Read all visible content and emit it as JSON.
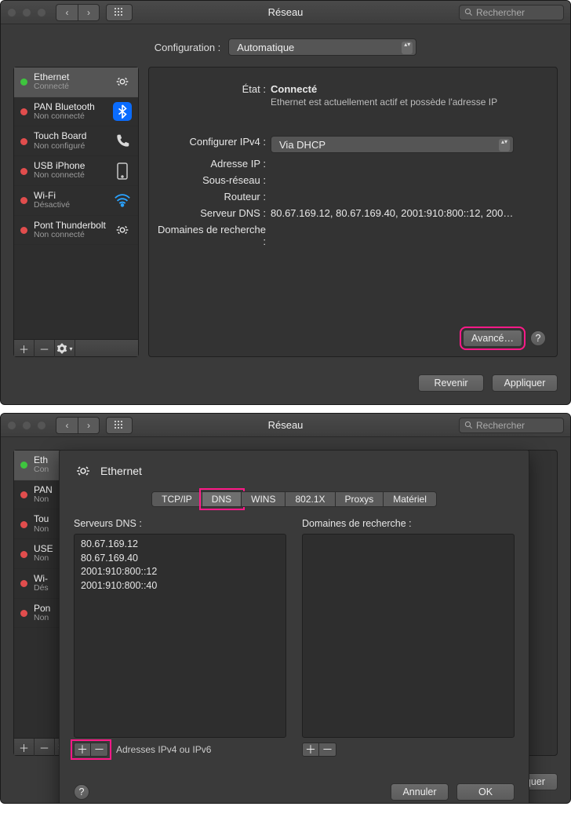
{
  "window1": {
    "title": "Réseau",
    "search_placeholder": "Rechercher",
    "config_label": "Configuration :",
    "config_value": "Automatique",
    "sidebar": {
      "items": [
        {
          "name": "Ethernet",
          "sub": "Connecté",
          "status": "green",
          "icon": "ethernet"
        },
        {
          "name": "PAN Bluetooth",
          "sub": "Non connecté",
          "status": "red",
          "icon": "bluetooth"
        },
        {
          "name": "Touch Board",
          "sub": "Non configuré",
          "status": "red",
          "icon": "phone"
        },
        {
          "name": "USB iPhone",
          "sub": "Non connecté",
          "status": "red",
          "icon": "iphone"
        },
        {
          "name": "Wi-Fi",
          "sub": "Désactivé",
          "status": "red",
          "icon": "wifi"
        },
        {
          "name": "Pont Thunderbolt",
          "sub": "Non connecté",
          "status": "red",
          "icon": "ethernet"
        }
      ]
    },
    "detail": {
      "state_label": "État :",
      "state_value": "Connecté",
      "state_desc": "Ethernet est actuellement actif et possède l'adresse IP",
      "ipv4_label": "Configurer IPv4 :",
      "ipv4_value": "Via DHCP",
      "ip_label": "Adresse IP :",
      "subnet_label": "Sous-réseau :",
      "router_label": "Routeur :",
      "dns_label": "Serveur DNS :",
      "dns_value": "80.67.169.12, 80.67.169.40, 2001:910:800::12, 200…",
      "search_domains_label": "Domaines de recherche :",
      "advanced": "Avancé…"
    },
    "footer": {
      "revert": "Revenir",
      "apply": "Appliquer"
    }
  },
  "window2": {
    "title": "Réseau",
    "search_placeholder": "Rechercher",
    "sheet": {
      "iface": "Ethernet",
      "tabs": [
        "TCP/IP",
        "DNS",
        "WINS",
        "802.1X",
        "Proxys",
        "Matériel"
      ],
      "active_tab": 1,
      "dns_servers_label": "Serveurs DNS :",
      "dns_servers": [
        "80.67.169.12",
        "80.67.169.40",
        "2001:910:800::12",
        "2001:910:800::40"
      ],
      "search_domains_label": "Domaines de recherche :",
      "addr_hint": "Adresses IPv4 ou IPv6",
      "cancel": "Annuler",
      "ok": "OK"
    },
    "under_footer": {
      "apply_partial": "iquer"
    },
    "sidebar": {
      "items": [
        {
          "name": "Eth",
          "sub": "Con",
          "status": "green"
        },
        {
          "name": "PAN",
          "sub": "Non",
          "status": "red"
        },
        {
          "name": "Tou",
          "sub": "Non",
          "status": "red"
        },
        {
          "name": "USE",
          "sub": "Non",
          "status": "red"
        },
        {
          "name": "Wi-",
          "sub": "Dés",
          "status": "red"
        },
        {
          "name": "Pon",
          "sub": "Non",
          "status": "red"
        }
      ]
    }
  }
}
